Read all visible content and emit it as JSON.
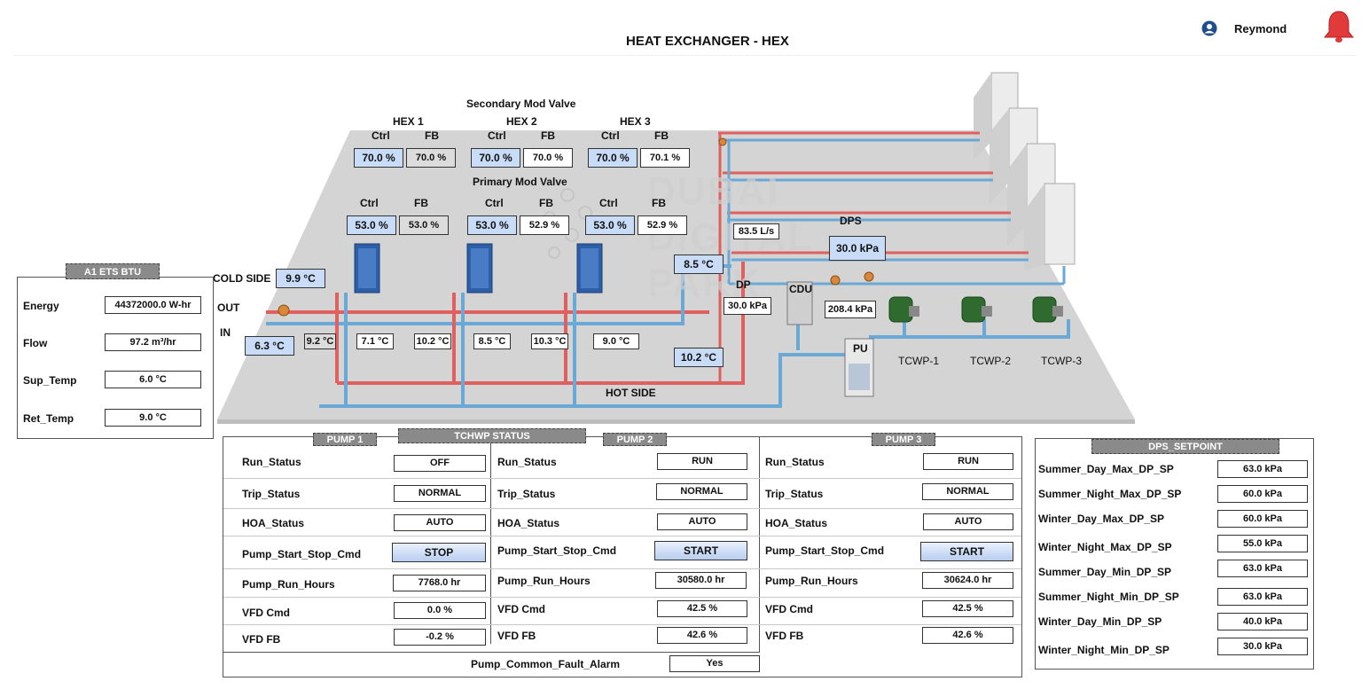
{
  "header": {
    "title": "HEAT EXCHANGER - HEX",
    "user_name": "Reymond"
  },
  "diagram": {
    "secondary_mod_valve": "Secondary Mod Valve",
    "primary_mod_valve": "Primary Mod Valve",
    "watermark": [
      "DUBAI",
      "DIGITAL",
      "PARK"
    ],
    "hex": [
      {
        "name": "HEX 1",
        "sec_ctrl": "70.0 %",
        "sec_fb": "70.0 %",
        "pri_ctrl": "53.0 %",
        "pri_fb": "53.0 %"
      },
      {
        "name": "HEX 2",
        "sec_ctrl": "70.0 %",
        "sec_fb": "70.0 %",
        "pri_ctrl": "53.0 %",
        "pri_fb": "52.9 %"
      },
      {
        "name": "HEX 3",
        "sec_ctrl": "70.0 %",
        "sec_fb": "70.1 %",
        "pri_ctrl": "53.0 %",
        "pri_fb": "52.9 %"
      }
    ],
    "ctrl_label": "Ctrl",
    "fb_label": "FB",
    "cold_side_label": "COLD SIDE",
    "cold_side_temp": "9.9 °C",
    "out_label": "OUT",
    "in_label": "IN",
    "in_temp": "6.3 °C",
    "temps": [
      "9.2 °C",
      "7.1 °C",
      "10.2 °C",
      "8.5 °C",
      "10.3 °C",
      "9.0 °C"
    ],
    "supply_temp": "8.5 °C",
    "return_temp": "10.2 °C",
    "hot_side_label": "HOT SIDE",
    "flow": "83.5 L/s",
    "dps_label": "DPS",
    "dps_value": "30.0 kPa",
    "dp_label": "DP",
    "dp_value": "30.0 kPa",
    "cdu_label": "CDU",
    "cdu_value": "208.4 kPa",
    "pu_label": "PU",
    "pumps": [
      "TCWP-1",
      "TCWP-2",
      "TCWP-3"
    ]
  },
  "btu": {
    "title": "A1 ETS BTU",
    "rows": [
      {
        "label": "Energy",
        "value": "44372000.0 W-hr"
      },
      {
        "label": "Flow",
        "value": "97.2 m³/hr"
      },
      {
        "label": "Sup_Temp",
        "value": "6.0 °C"
      },
      {
        "label": "Ret_Temp",
        "value": "9.0 °C"
      }
    ]
  },
  "tchwp": {
    "title": "TCHWP STATUS",
    "row_labels": [
      "Run_Status",
      "Trip_Status",
      "HOA_Status",
      "Pump_Start_Stop_Cmd",
      "Pump_Run_Hours",
      "VFD Cmd",
      "VFD FB"
    ],
    "pumps": [
      {
        "name": "PUMP 1",
        "run": "OFF",
        "trip": "NORMAL",
        "hoa": "AUTO",
        "cmd": "STOP",
        "hours": "7768.0 hr",
        "vfd_cmd": "0.0 %",
        "vfd_fb": "-0.2 %"
      },
      {
        "name": "PUMP 2",
        "run": "RUN",
        "trip": "NORMAL",
        "hoa": "AUTO",
        "cmd": "START",
        "hours": "30580.0 hr",
        "vfd_cmd": "42.5 %",
        "vfd_fb": "42.6 %"
      },
      {
        "name": "PUMP 3",
        "run": "RUN",
        "trip": "NORMAL",
        "hoa": "AUTO",
        "cmd": "START",
        "hours": "30624.0 hr",
        "vfd_cmd": "42.5 %",
        "vfd_fb": "42.6 %"
      }
    ],
    "common_fault_label": "Pump_Common_Fault_Alarm",
    "common_fault_value": "Yes"
  },
  "dps_setpoint": {
    "title": "DPS_SETPOINT",
    "rows": [
      {
        "label": "Summer_Day_Max_DP_SP",
        "value": "63.0 kPa"
      },
      {
        "label": "Summer_Night_Max_DP_SP",
        "value": "60.0 kPa"
      },
      {
        "label": "Winter_Day_Max_DP_SP",
        "value": "60.0 kPa"
      },
      {
        "label": "Winter_Night_Max_DP_SP",
        "value": "55.0 kPa"
      },
      {
        "label": "Summer_Day_Min_DP_SP",
        "value": "63.0 kPa"
      },
      {
        "label": "Summer_Night_Min_DP_SP",
        "value": "63.0 kPa"
      },
      {
        "label": "Winter_Day_Min_DP_SP",
        "value": "40.0 kPa"
      },
      {
        "label": "Winter_Night_Min_DP_SP",
        "value": "30.0 kPa"
      }
    ]
  }
}
